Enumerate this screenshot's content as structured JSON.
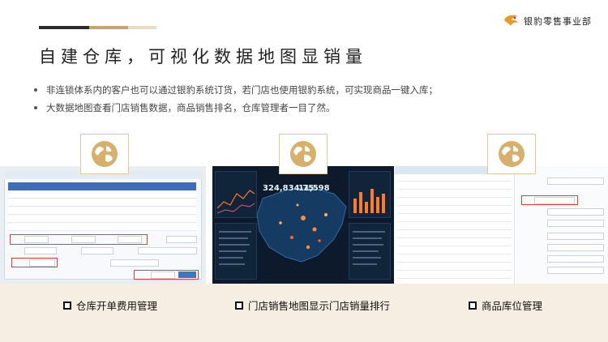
{
  "brand": {
    "name": "银豹零售事业部",
    "colors": {
      "dark": "#2b2b2b",
      "gold": "#c9a46a",
      "beige": "#f6eee2",
      "accent_red": "#e0413c",
      "logo_orange": "#e89a2c"
    }
  },
  "title": "自建仓库，可视化数据地图显销量",
  "bullets": [
    "非连锁体系内的客户也可以通过银豹系统订货，若门店也使用银豹系统，可实现商品一键入库；",
    "大数据地图查看门店销售数据，商品销售排名，仓库管理者一目了然。"
  ],
  "badge_icon": "globe-icon",
  "panels": [
    {
      "caption": "仓库开单费用管理",
      "screenshot": "warehouse-order-form"
    },
    {
      "caption": "门店销售地图显示门店销量排行",
      "screenshot": "sales-map-dashboard",
      "map_values": [
        "324,834.75",
        "11,598"
      ]
    },
    {
      "caption": "商品库位管理",
      "screenshot": "product-location-list"
    }
  ]
}
